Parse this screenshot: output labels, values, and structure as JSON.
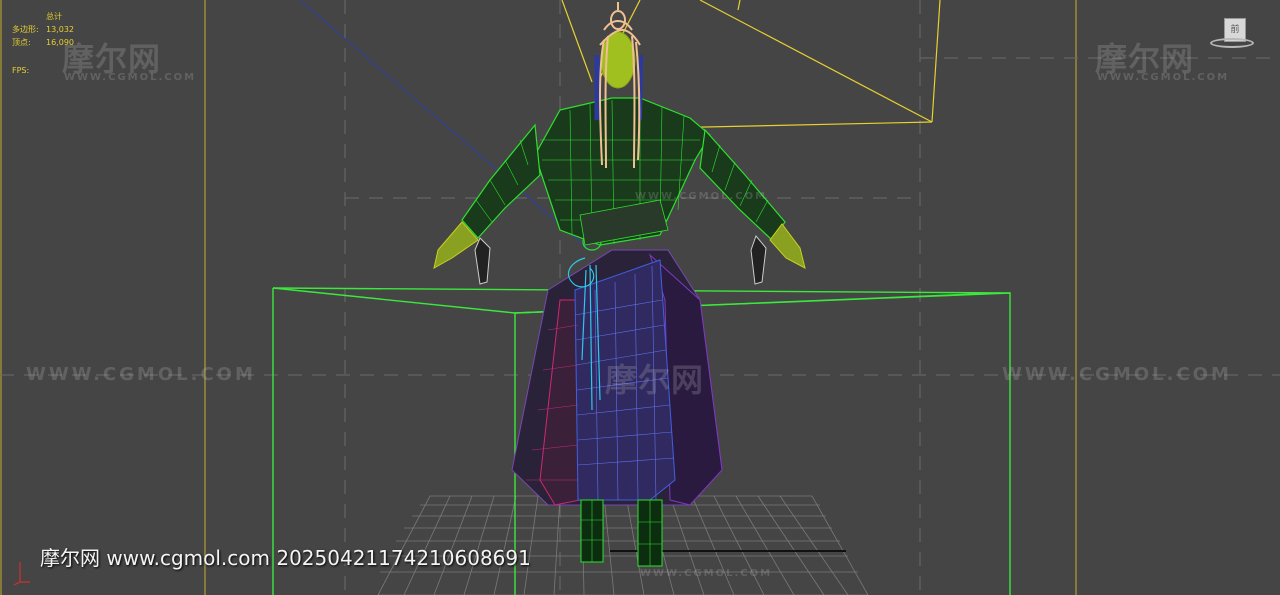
{
  "stats": {
    "title": "总计",
    "polys_label": "多边形:",
    "polys_value": "13,032",
    "verts_label": "顶点:",
    "verts_value": "16,090",
    "fps_label": "FPS:"
  },
  "viewcube": {
    "face_label": "前"
  },
  "watermarks": {
    "logo": "摩尔网",
    "url_small": "WWW.CGMOL.COM",
    "url_large": "WWW.CGMOL.COM"
  },
  "caption": "摩尔网 www.cgmol.com 20250421174210608691",
  "colors": {
    "background": "#454545",
    "stats_text": "#e8d030",
    "bounding_box": "#3ce83c",
    "camera": "#e8d030",
    "grid": "#8a8a8a",
    "body_wire": "#2ee02e",
    "robe_wire": "#9060d0",
    "sash_wire": "#30c8e8",
    "hair_wire": "#f0c090",
    "face_fill": "#a0c020"
  },
  "icons": {
    "viewcube": "viewcube-icon",
    "axis": "axis-tripod-icon"
  }
}
